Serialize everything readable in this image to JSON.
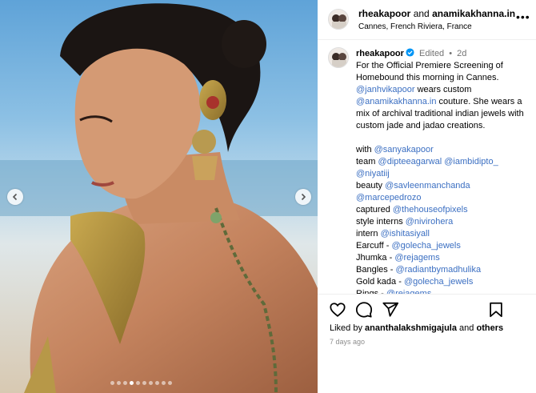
{
  "post": {
    "author": "rheakapoor",
    "joiner": "and",
    "coauthor": "anamikakhanna.in",
    "location": "Cannes, French Riviera, France"
  },
  "caption": {
    "username": "rheakapoor",
    "edited": "Edited",
    "sep": "•",
    "age": "2d",
    "intro_1": "For the Official Premiere Screening of Homebound this morning in Cannes.",
    "m_janhvi": "@janhvikapoor",
    "intro_2": " wears custom ",
    "m_anamika": "@anamikakhanna.in",
    "intro_3": " couture. She wears a mix of archival traditional indian jewels with custom jade and jadao creations.",
    "credits": [
      {
        "label": "with",
        "mentions": [
          "@sanyakapoor"
        ]
      },
      {
        "label": "team",
        "mentions": [
          "@dipteeagarwal",
          "@iambidipto_",
          "@niyatiij"
        ]
      },
      {
        "label": "beauty",
        "mentions": [
          "@savleenmanchanda",
          "@marcepedrozo"
        ]
      },
      {
        "label": "captured",
        "mentions": [
          "@thehouseofpixels"
        ]
      },
      {
        "label": "style interns",
        "mentions": [
          "@nivirohera"
        ]
      },
      {
        "label": "intern",
        "mentions": [
          "@ishitasiyall"
        ]
      },
      {
        "label": "Earcuff -",
        "mentions": [
          "@golecha_jewels"
        ]
      },
      {
        "label": "Jhumka -",
        "mentions": [
          "@rejagems"
        ]
      },
      {
        "label": "Bangles -",
        "mentions": [
          "@radiantbymadhulika"
        ]
      },
      {
        "label": "Gold kada -",
        "mentions": [
          "@golecha_jewels"
        ]
      },
      {
        "label": "Rings -",
        "mentions": [
          "@rejagems"
        ]
      }
    ]
  },
  "likes": {
    "prefix": "Liked by",
    "user": "ananthalakshmigajula",
    "and": "and",
    "others": "others"
  },
  "timestamp": "7 days ago",
  "carousel": {
    "total": 10,
    "active": 3
  },
  "icons": [
    "more-icon",
    "verified-icon",
    "heart-icon",
    "comment-icon",
    "share-icon",
    "bookmark-icon",
    "chevron-left-icon",
    "chevron-right-icon"
  ],
  "colors": {
    "link": "#3b6fc2",
    "verified": "#0095f6",
    "muted": "#737373"
  }
}
